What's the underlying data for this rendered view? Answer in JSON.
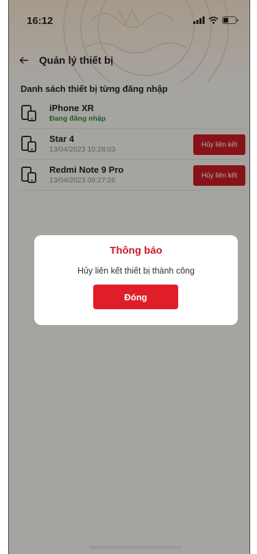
{
  "status": {
    "time": "16:12"
  },
  "header": {
    "title": "Quản lý thiết bị"
  },
  "section_title": "Danh sách thiết bị từng đăng nhập",
  "devices": [
    {
      "name": "iPhone XR",
      "sub": "Đang đăng nhập"
    },
    {
      "name": "Star 4",
      "sub": "13/04/2023 10:28:03",
      "action": "Hủy liên kết"
    },
    {
      "name": "Redmi Note 9 Pro",
      "sub": "13/04/2023 09:27:26",
      "action": "Hủy liên kết"
    }
  ],
  "dialog": {
    "title": "Thông báo",
    "message": "Hủy liên kết thiết bị thành công",
    "button": "Đóng"
  },
  "colors": {
    "accent": "#c81d25",
    "active": "#2e8b3d"
  }
}
